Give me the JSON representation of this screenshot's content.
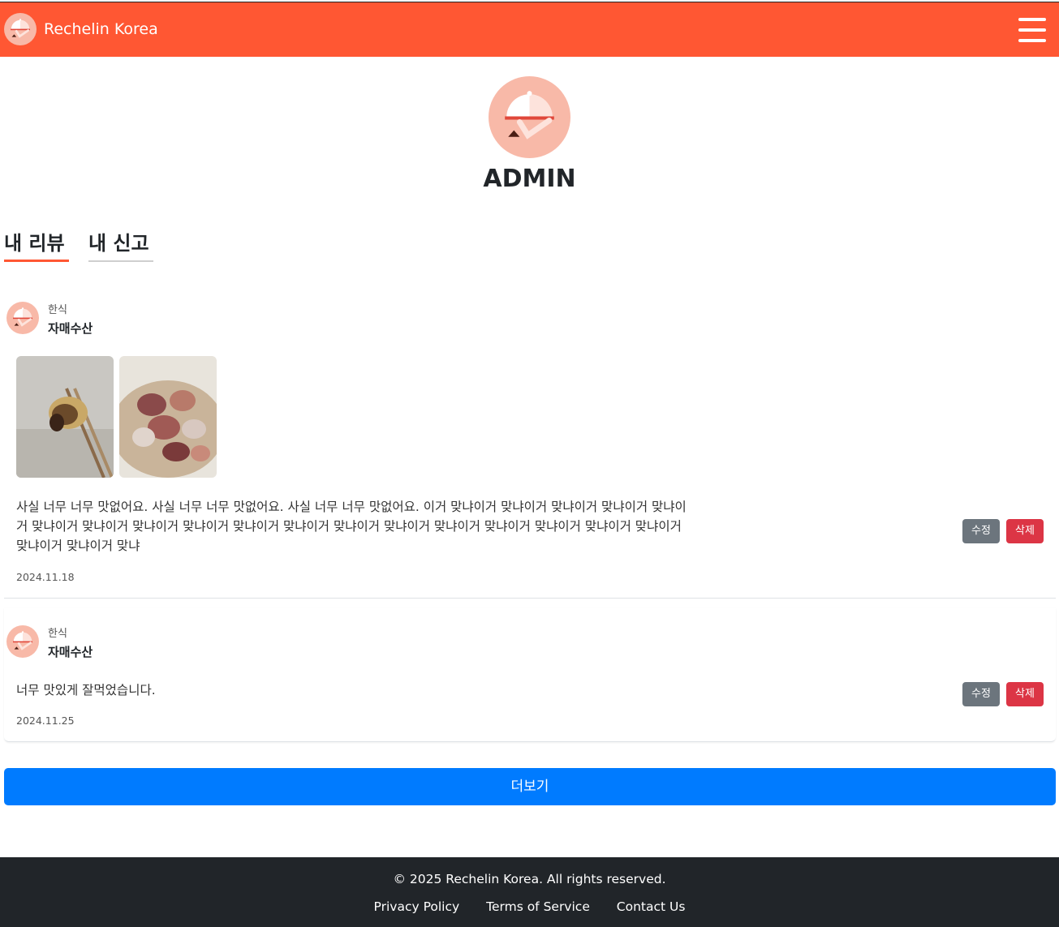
{
  "navbar": {
    "brand": "Rechelin Korea",
    "background": "#ff5733"
  },
  "profile": {
    "name": "ADMIN"
  },
  "tabs": [
    {
      "label": "내 리뷰",
      "active": true
    },
    {
      "label": "내 신고",
      "active": false
    }
  ],
  "reviews": [
    {
      "category": "한식",
      "restaurant": "자매수산",
      "photos": [
        "scallop-on-chopsticks-photo",
        "scallop-plate-photo"
      ],
      "text": "사실 너무 너무 맛없어요. 사실 너무 너무 맛없어요. 사실 너무 너무 맛없어요. 이거 맞냐이거 맞냐이거 맞냐이거 맞냐이거 맞냐이거 맞냐이거 맞냐이거 맞냐이거 맞냐이거 맞냐이거 맞냐이거 맞냐이거 맞냐이거 맞냐이거 맞냐이거 맞냐이거 맞냐이거 맞냐이거 맞냐이거 맞냐이거 맞냐",
      "date": "2024.11.18",
      "edit_label": "수정",
      "delete_label": "삭제"
    },
    {
      "category": "한식",
      "restaurant": "자매수산",
      "photos": [],
      "text": "너무 맛있게 잘먹었습니다.",
      "date": "2024.11.25",
      "edit_label": "수정",
      "delete_label": "삭제"
    }
  ],
  "more_label": "더보기",
  "footer": {
    "copyright": "© 2025 Rechelin Korea. All rights reserved.",
    "links": [
      "Privacy Policy",
      "Terms of Service",
      "Contact Us"
    ]
  },
  "colors": {
    "brand": "#ff5733",
    "more_button": "#007bff",
    "edit_button": "#6c757d",
    "delete_button": "#dc3545",
    "footer": "#212529"
  }
}
